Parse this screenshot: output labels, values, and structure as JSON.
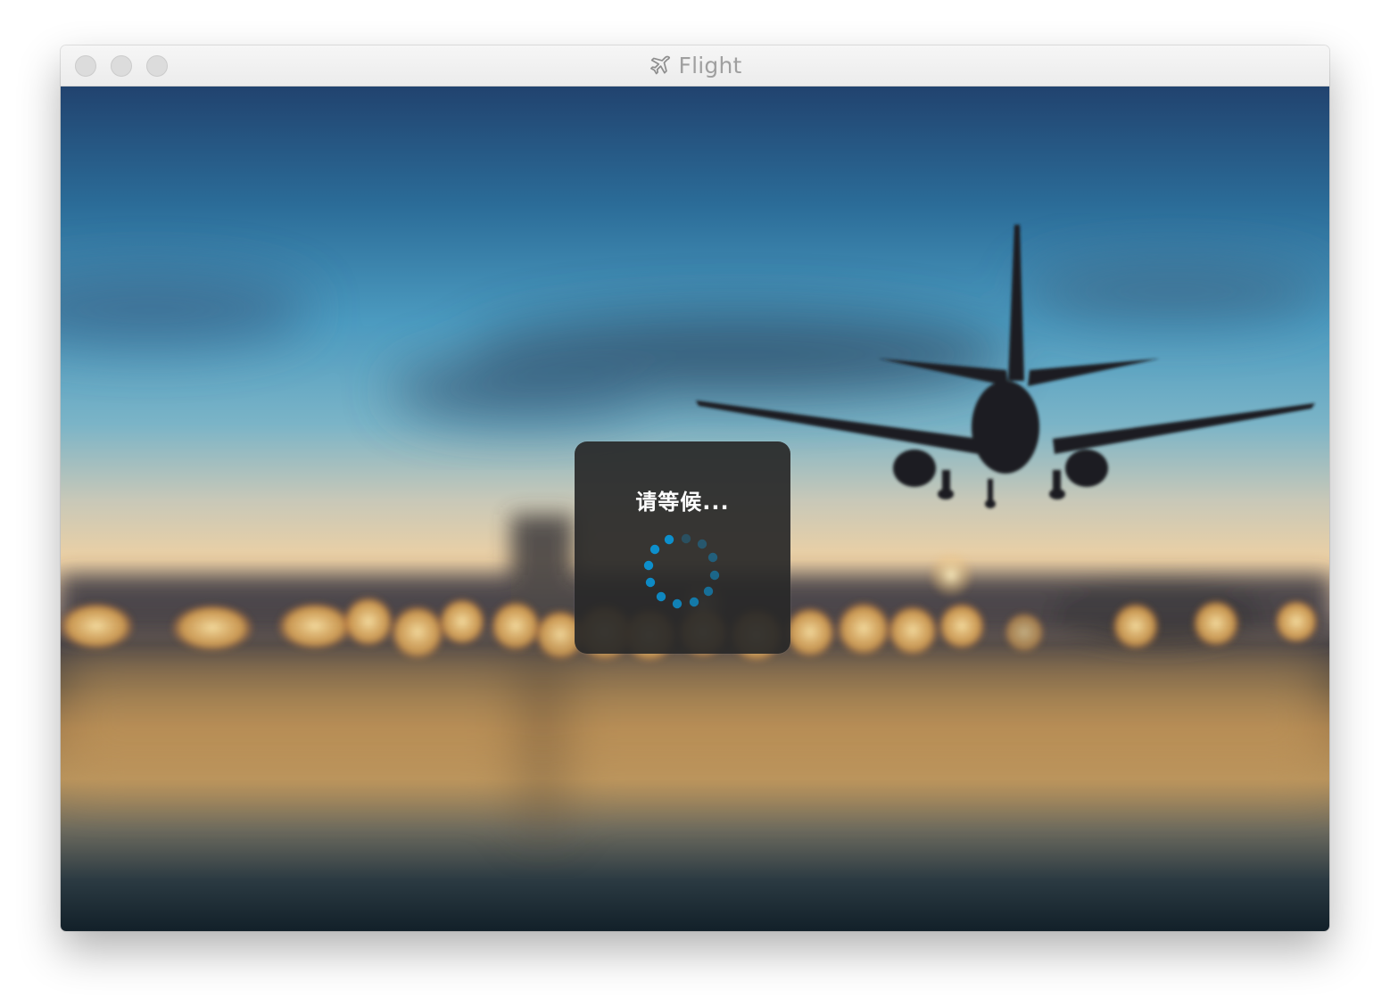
{
  "window": {
    "title": "Flight",
    "title_icon": "airplane-icon",
    "controls": [
      "close",
      "minimize",
      "zoom"
    ]
  },
  "loading": {
    "message": "请等候...",
    "spinner_icon": "loading-spinner-icon",
    "accent_color": "#0d8fcc"
  }
}
